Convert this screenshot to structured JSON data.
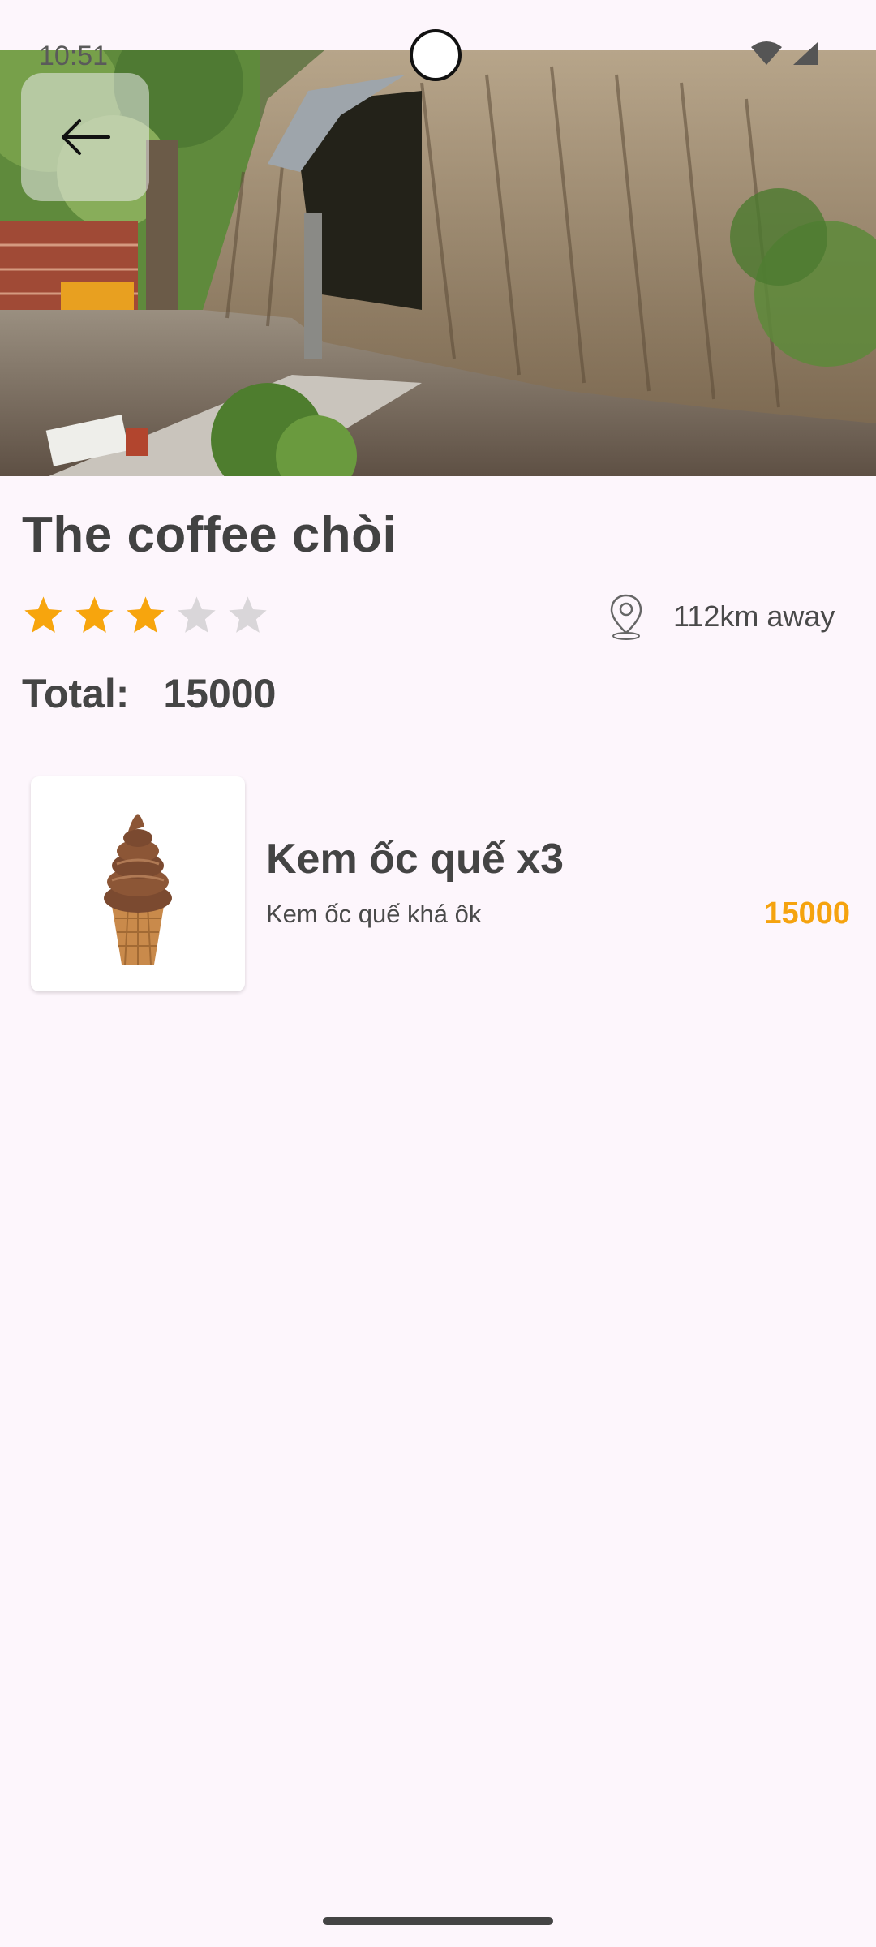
{
  "status_bar": {
    "time": "10:51",
    "icons": [
      "wifi-icon",
      "signal-icon"
    ]
  },
  "header": {
    "back_icon": "arrow-left-icon"
  },
  "place": {
    "name": "The coffee chòi",
    "rating": 3,
    "max_rating": 5,
    "distance": "112km away",
    "distance_icon": "location-pin-icon"
  },
  "order": {
    "total_label": "Total:",
    "total_value": "15000",
    "items": [
      {
        "name": "Kem ốc quế x3",
        "description": "Kem ốc quế khá ôk",
        "price": "15000",
        "image": "ice-cream-cone"
      }
    ]
  },
  "colors": {
    "background": "#fdf6fc",
    "accent": "#f5a30f",
    "star_filled": "#f7a50d",
    "star_empty": "#d9d6d9"
  }
}
